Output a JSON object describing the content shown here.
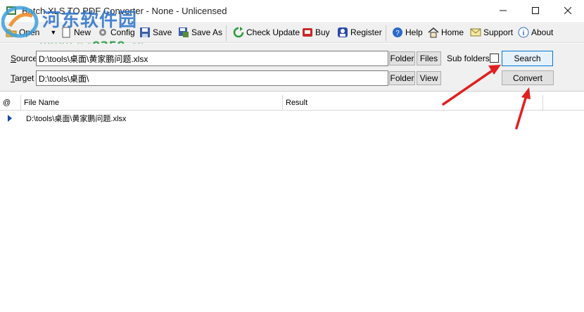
{
  "window": {
    "title": "Batch XLS TO PDF Converter - None - Unlicensed",
    "minimize_glyph": "—",
    "maximize_glyph": "☐",
    "close_glyph": "✕"
  },
  "toolbar": {
    "open_label": "Open",
    "new_label": "New",
    "config_label": "Config",
    "save_label": "Save",
    "save_as_label": "Save As",
    "check_update_label": "Check Update",
    "buy_label": "Buy",
    "register_label": "Register",
    "help_label": "Help",
    "home_label": "Home",
    "support_label": "Support",
    "about_label": "About"
  },
  "panel": {
    "source_label_prefix": "S",
    "source_label_rest": "ource",
    "source_value": "D:\\tools\\桌面\\黄家鹏问题.xlsx",
    "target_label_prefix": "T",
    "target_label_rest": "arget",
    "target_value": "D:\\tools\\桌面\\",
    "folder_label": "Folder",
    "files_label": "Files",
    "view_label": "View",
    "subfolders_label": "Sub folders",
    "search_label": "Search",
    "convert_label": "Convert"
  },
  "grid": {
    "columns": [
      "@",
      "File Name",
      "Result"
    ],
    "rows": [
      {
        "file": "D:\\tools\\桌面\\黄家鹏问题.xlsx",
        "result": ""
      }
    ]
  },
  "watermark": {
    "title": "河东软件园",
    "url": "www.pc0359.cn"
  },
  "colors": {
    "accent": "#0078d7",
    "toolbar_bg": "#f0f0f0",
    "arrow": "#e02020"
  }
}
